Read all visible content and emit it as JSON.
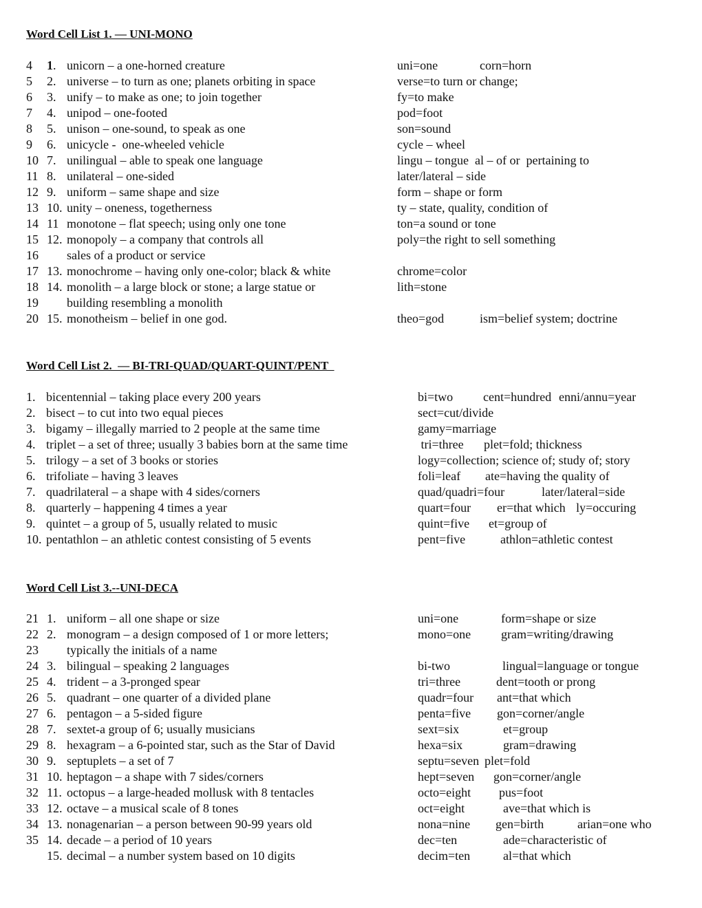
{
  "sections": [
    {
      "title": "Word Cell List 1. — UNI-MONO",
      "rows": [
        {
          "ln": "4",
          "num": "1.",
          "def": "unicorn – a one-horned creature",
          "roots": [
            "uni=one",
            "corn=horn"
          ]
        },
        {
          "ln": "5",
          "num": "2.",
          "def": "universe – to turn as one; planets orbiting in space",
          "roots": [
            "verse=to turn or change;"
          ]
        },
        {
          "ln": "6",
          "num": "3.",
          "def": "unify – to make as one; to join together",
          "roots": [
            "fy=to make"
          ]
        },
        {
          "ln": "7",
          "num": "4.",
          "def": "unipod – one-footed",
          "roots": [
            "pod=foot"
          ]
        },
        {
          "ln": "8",
          "num": "5.",
          "def": "unison – one-sound, to speak as one",
          "roots": [
            "son=sound"
          ]
        },
        {
          "ln": "9",
          "num": "6.",
          "def": "unicycle -  one-wheeled vehicle",
          "roots": [
            "cycle – wheel"
          ]
        },
        {
          "ln": "10",
          "num": "7.",
          "def": "unilingual – able to speak one language",
          "roots": [
            "lingu – tongue  al – of or  pertaining to"
          ]
        },
        {
          "ln": "11",
          "num": "8.",
          "def": "unilateral – one-sided",
          "roots": [
            "later/lateral – side"
          ]
        },
        {
          "ln": "12",
          "num": "9.",
          "def": "uniform – same shape and size",
          "roots": [
            "form – shape or form"
          ]
        },
        {
          "ln": "13",
          "num": "10.",
          "def": "unity – oneness, togetherness",
          "roots": [
            "ty – state, quality, condition of"
          ]
        },
        {
          "ln": "14",
          "num": "11",
          "def": "monotone – flat speech; using only one tone",
          "roots": [
            "ton=a sound or tone"
          ]
        },
        {
          "ln": "15",
          "num": "12.",
          "def": "monopoly – a company that controls all",
          "roots": [
            "poly=the right to sell something"
          ]
        },
        {
          "ln": "16",
          "num": "",
          "def": "sales of a product or service",
          "roots": []
        },
        {
          "ln": "17",
          "num": "13.",
          "def": "monochrome – having only one-color; black & white",
          "roots": [
            "chrome=color"
          ]
        },
        {
          "ln": "18",
          "num": "14.",
          "def": "monolith – a large block or stone; a large statue or",
          "roots": [
            "lith=stone"
          ]
        },
        {
          "ln": "19",
          "num": "",
          "def": "building resembling a monolith",
          "roots": []
        },
        {
          "ln": "20",
          "num": "15.",
          "def": "monotheism – belief in one god.",
          "roots": [
            "theo=god",
            "ism=belief system; doctrine"
          ]
        }
      ]
    },
    {
      "title": "Word Cell List 2.  — BI-TRI-QUAD/QUART-QUINT/PENT  ",
      "rows": [
        {
          "ln": "",
          "num": "1.",
          "def": "bicentennial – taking place every 200 years",
          "roots": [
            "bi=two",
            "cent=hundred",
            "enni/annu=year"
          ]
        },
        {
          "ln": "",
          "num": "2.",
          "def": "bisect – to cut into two equal pieces",
          "roots": [
            "sect=cut/divide"
          ]
        },
        {
          "ln": "",
          "num": "3.",
          "def": "bigamy – illegally married to 2 people at the same time",
          "roots": [
            "gamy=marriage"
          ]
        },
        {
          "ln": "",
          "num": "4.",
          "def": "triplet – a set of three; usually 3 babies born at the same time",
          "roots": [
            " tri=three",
            "plet=fold; thickness"
          ]
        },
        {
          "ln": "",
          "num": "5.",
          "def": "trilogy – a set of 3 books or stories",
          "roots": [
            "logy=collection; science of; study of; story"
          ]
        },
        {
          "ln": "",
          "num": "6.",
          "def": "trifoliate – having 3 leaves",
          "roots": [
            "foli=leaf",
            "ate=having the quality of"
          ]
        },
        {
          "ln": "",
          "num": "7.",
          "def": "quadrilateral – a shape with 4 sides/corners",
          "roots": [
            "quad/quadri=four",
            "later/lateral=side"
          ]
        },
        {
          "ln": "",
          "num": "8.",
          "def": "quarterly – happening 4 times a year",
          "roots": [
            "quart=four",
            "er=that which",
            "ly=occuring"
          ]
        },
        {
          "ln": "",
          "num": "9.",
          "def": "quintet – a group of 5, usually related to music",
          "roots": [
            "quint=five",
            "et=group of"
          ]
        },
        {
          "ln": "",
          "num": "10.",
          "def": "pentathlon – an athletic contest consisting of 5 events",
          "roots": [
            "pent=five",
            "athlon=athletic contest"
          ]
        }
      ]
    },
    {
      "title": "Word Cell List 3.--UNI-DECA",
      "rows": [
        {
          "ln": "21",
          "num": "1.",
          "def": "uniform – all one shape or size",
          "roots": [
            "uni=one",
            "form=shape or size"
          ]
        },
        {
          "ln": "22",
          "num": "2.",
          "def": "monogram – a design composed of 1 or more letters;",
          "roots": [
            "mono=one",
            "gram=writing/drawing"
          ]
        },
        {
          "ln": "23",
          "num": "",
          "def": "typically the initials of a name",
          "roots": []
        },
        {
          "ln": "24",
          "num": "3.",
          "def": "bilingual – speaking 2 languages",
          "roots": [
            "bi-two",
            "lingual=language or tongue"
          ]
        },
        {
          "ln": "25",
          "num": "4.",
          "def": "trident – a 3-pronged spear",
          "roots": [
            "tri=three",
            "dent=tooth or prong"
          ]
        },
        {
          "ln": "26",
          "num": "5.",
          "def": "quadrant – one quarter of a divided plane",
          "roots": [
            "quadr=four",
            "ant=that which"
          ]
        },
        {
          "ln": "27",
          "num": "6.",
          "def": "pentagon – a 5-sided figure",
          "roots": [
            "penta=five",
            "gon=corner/angle"
          ]
        },
        {
          "ln": "28",
          "num": "7.",
          "def": "sextet-a group of 6; usually musicians",
          "roots": [
            "sext=six",
            "et=group"
          ]
        },
        {
          "ln": "29",
          "num": "8.",
          "def": "hexagram – a 6-pointed star, such as the Star of David",
          "roots": [
            "hexa=six",
            "gram=drawing"
          ]
        },
        {
          "ln": "30",
          "num": "9.",
          "def": "septuplets – a set of 7",
          "roots": [
            "septu=seven",
            "plet=fold"
          ]
        },
        {
          "ln": "31",
          "num": "10.",
          "def": "heptagon – a shape with 7 sides/corners",
          "roots": [
            "hept=seven",
            "gon=corner/angle"
          ]
        },
        {
          "ln": "32",
          "num": "11.",
          "def": "octopus – a large-headed mollusk with 8 tentacles",
          "roots": [
            "octo=eight",
            "pus=foot"
          ]
        },
        {
          "ln": "33",
          "num": "12.",
          "def": "octave – a musical scale of 8 tones",
          "roots": [
            "oct=eight",
            "ave=that which is"
          ]
        },
        {
          "ln": "34",
          "num": "13.",
          "def": "nonagenarian – a person between 90-99 years old",
          "roots": [
            "nona=nine",
            "gen=birth",
            "arian=one who"
          ]
        },
        {
          "ln": "35",
          "num": "14.",
          "def": "decade – a period of 10 years",
          "roots": [
            "dec=ten",
            "ade=characteristic of"
          ]
        },
        {
          "ln": "",
          "num": "15.",
          "def": "decimal – a number system based on 10 digits",
          "roots": [
            "decim=ten",
            "al=that which"
          ]
        }
      ]
    }
  ]
}
